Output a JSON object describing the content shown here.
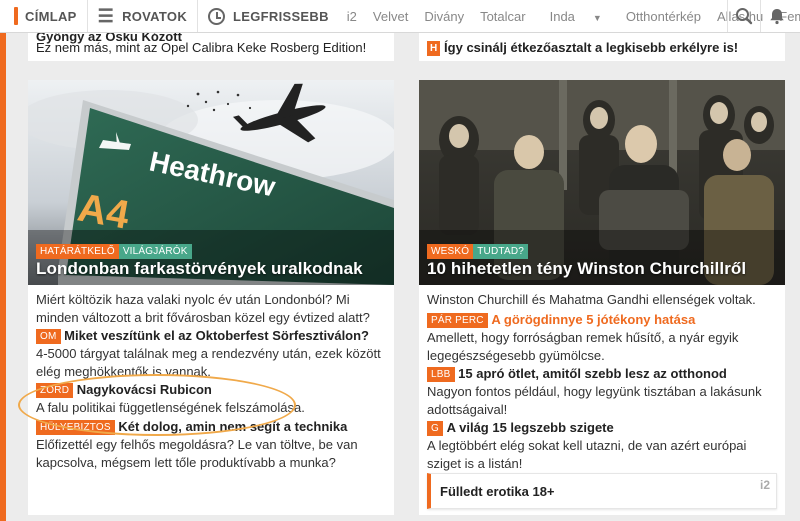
{
  "nav": {
    "home_label": "CÍMLAP",
    "sections_label": "ROVATOK",
    "latest_label": "LEGFRISSEBB",
    "sites": [
      "i2",
      "Velvet",
      "Divány",
      "Totalcar",
      "Inda",
      "Otthontérkép",
      "Allas.hu",
      "Femina"
    ],
    "dropdown_chevron": "▼"
  },
  "colors": {
    "accent": "#ef6a1f",
    "tag_green": "#48a78a",
    "highlight_circle": "#f0a94a"
  },
  "top_strip": {
    "left_cut_text": "Gyöngy az Osku Kózott",
    "left_text": "Ez nem más, mint az Opel Calibra Keke Rosberg Edition!",
    "right_badge": "H",
    "right_text": "Így csinálj étkezőasztalt a legkisebb erkélyre is!"
  },
  "left_card": {
    "tags": [
      "HATÁRÁTKELŐ",
      "VILÁGJÁRÓK"
    ],
    "title": "Londonban farkastörvények uralkodnak",
    "lead": "Miért költözik haza valaki nyolc év után Londonból? Mi minden változott a brit fővárosban közel egy évtized alatt?",
    "items": [
      {
        "badge": "OM",
        "headline": "Miket veszítünk el az Oktoberfest Sörfesztiválon?",
        "text": "4-5000 tárgyat találnak meg a rendezvény után, ezek között elég meghökkentők is vannak."
      },
      {
        "badge": "ZORD",
        "headline": "Nagykovácsi Rubicon",
        "text": "A falu politikai függetlenségének felszámolása."
      },
      {
        "badge": "HÜLYEBIZTOS",
        "headline": "Két dolog, amin nem segít a technika",
        "text": "Előfizettél egy felhős megoldásra? Le van töltve, be van kapcsolva, mégsem lett tőle produktívabb a munka?"
      }
    ],
    "image_labels": {
      "road": "A4",
      "airport": "Heathrow"
    }
  },
  "right_card": {
    "tags": [
      "WESKÓ",
      "TUDTAD?"
    ],
    "title": "10 hihetetlen tény Winston Churchillről",
    "lead": "Winston Churchill és Mahatma Gandhi ellenségek voltak.",
    "items": [
      {
        "badge": "PÁR PERC",
        "headline": "A görögdinnye 5 jótékony hatása",
        "text": "Amellett, hogy forróságban remek hűsítő, a nyár egyik legegészségesebb gyümölcse."
      },
      {
        "badge": "LBB",
        "headline": "15 apró ötlet, amitől szebb lesz az otthonod",
        "text": "Nagyon fontos például, hogy legyünk tisztában a lakásunk adottságaival!"
      },
      {
        "badge": "G",
        "headline": "A világ 15 legszebb szigete",
        "text": "A legtöbbért elég sokat kell utazni, de van azért európai sziget is a listán!"
      }
    ],
    "promo": {
      "label": "Fülledt erotika 18+",
      "site_mark": "i2"
    }
  },
  "icons": [
    "logo-mark-icon",
    "hamburger-icon",
    "clock-icon",
    "search-icon",
    "bell-icon",
    "chevron-down-icon",
    "airplane-icon"
  ]
}
